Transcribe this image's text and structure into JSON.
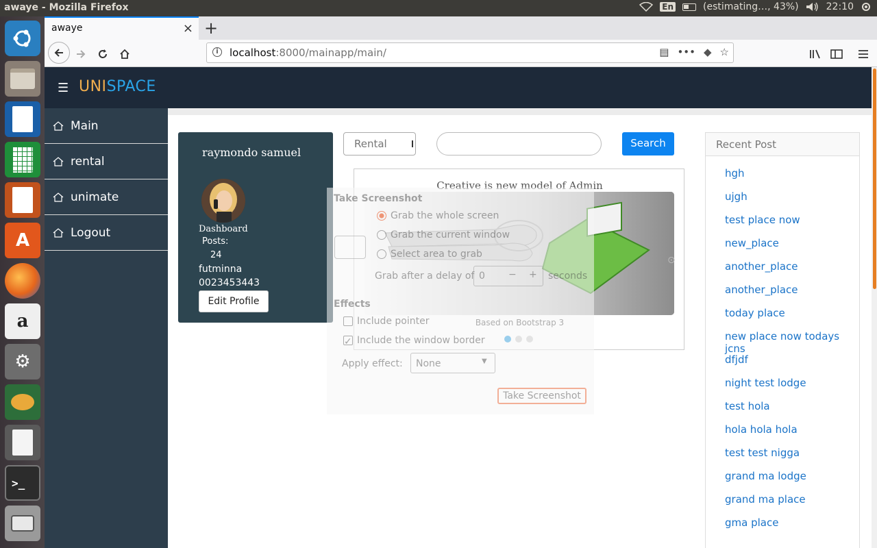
{
  "os": {
    "window_title": "awaye - Mozilla Firefox",
    "keyboard_layout": "En",
    "battery_status": "(estimating…, 43%)",
    "clock": "22:10"
  },
  "browser": {
    "tab_title": "awaye",
    "url_host": "localhost",
    "url_path": ":8000/mainapp/main/"
  },
  "site": {
    "brand_part1": "UNI",
    "brand_part2": "SPACE",
    "nav": [
      {
        "label": "Main"
      },
      {
        "label": "rental"
      },
      {
        "label": "unimate"
      },
      {
        "label": "Logout"
      }
    ]
  },
  "profile": {
    "name": "raymondo samuel",
    "dashboard_label": "Dashboard",
    "posts_label": "Posts:",
    "posts_count": "24",
    "location": "futminna",
    "phone": "0023453443",
    "edit_button": "Edit Profile"
  },
  "search": {
    "category_selected": "Rental",
    "button_label": "Search"
  },
  "carousel": {
    "title": "Creative is new model of Admin",
    "caption": "Based on Bootstrap 3",
    "slide_count": 3,
    "active_slide": 1
  },
  "screenshot_dialog": {
    "title": "Take Screenshot",
    "option_whole": "Grab the whole screen",
    "option_window": "Grab the current window",
    "option_area": "Select area to grab",
    "delay_label": "Grab after a delay of",
    "delay_value": "0",
    "delay_unit": "seconds",
    "effects_heading": "Effects",
    "include_pointer": "Include pointer",
    "include_border": "Include the window border",
    "apply_effect_label": "Apply effect:",
    "apply_effect_value": "None",
    "take_button": "Take Screenshot"
  },
  "recent_posts": {
    "heading": "Recent Post",
    "items": [
      "hgh",
      "ujgh",
      "test place now",
      "new_place",
      "another_place",
      "another_place",
      "today place",
      "new place now todays jcns",
      "dfjdf",
      "night test lodge",
      "test hola",
      "hola hola hola",
      "test test nigga",
      "grand ma lodge",
      "grand ma place",
      "gma place"
    ]
  },
  "colors": {
    "header_bg": "#1d2939",
    "sidebar_bg": "#2d3e4c",
    "brand_uni": "#f0ad4e",
    "brand_space": "#2aa4e8",
    "search_button": "#0d84f0",
    "link": "#1a73c8"
  }
}
